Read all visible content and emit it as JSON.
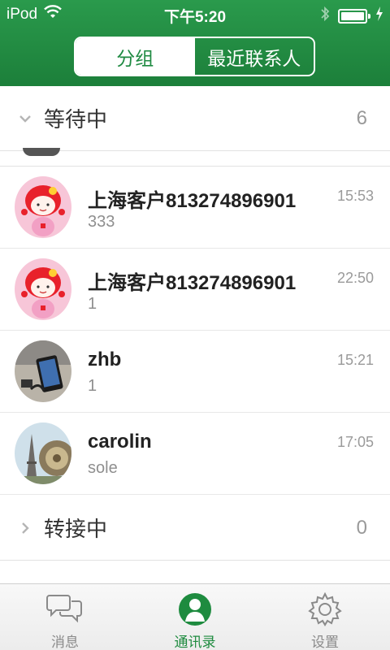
{
  "status_bar": {
    "carrier": "iPod",
    "time": "下午5:20"
  },
  "segmented": {
    "tabs": [
      {
        "label": "分组",
        "active": true
      },
      {
        "label": "最近联系人",
        "active": false
      }
    ]
  },
  "groups": [
    {
      "label": "等待中",
      "count": "6",
      "expanded": true
    },
    {
      "label": "转接中",
      "count": "0",
      "expanded": false
    }
  ],
  "conversations": [
    {
      "name": "上海客户813274896901",
      "message": "333",
      "time": "15:53",
      "avatar": "cartoon-girl-avatar"
    },
    {
      "name": "上海客户813274896901",
      "message": "1",
      "time": "22:50",
      "avatar": "cartoon-girl-avatar"
    },
    {
      "name": "zhb",
      "message": "1",
      "time": "15:21",
      "avatar": "phone-photo-avatar"
    },
    {
      "name": "carolin",
      "message": "sole",
      "time": "17:05",
      "avatar": "eiffel-tower-photo-avatar"
    }
  ],
  "tabbar": {
    "tabs": [
      {
        "label": "消息",
        "icon": "chat-bubbles-icon",
        "active": false
      },
      {
        "label": "通讯录",
        "icon": "contact-person-icon",
        "active": true
      },
      {
        "label": "设置",
        "icon": "gear-icon",
        "active": false
      }
    ]
  },
  "colors": {
    "brand_green": "#1f8a42",
    "header_top": "#2a9a4c",
    "header_bottom": "#1c7f3a"
  }
}
